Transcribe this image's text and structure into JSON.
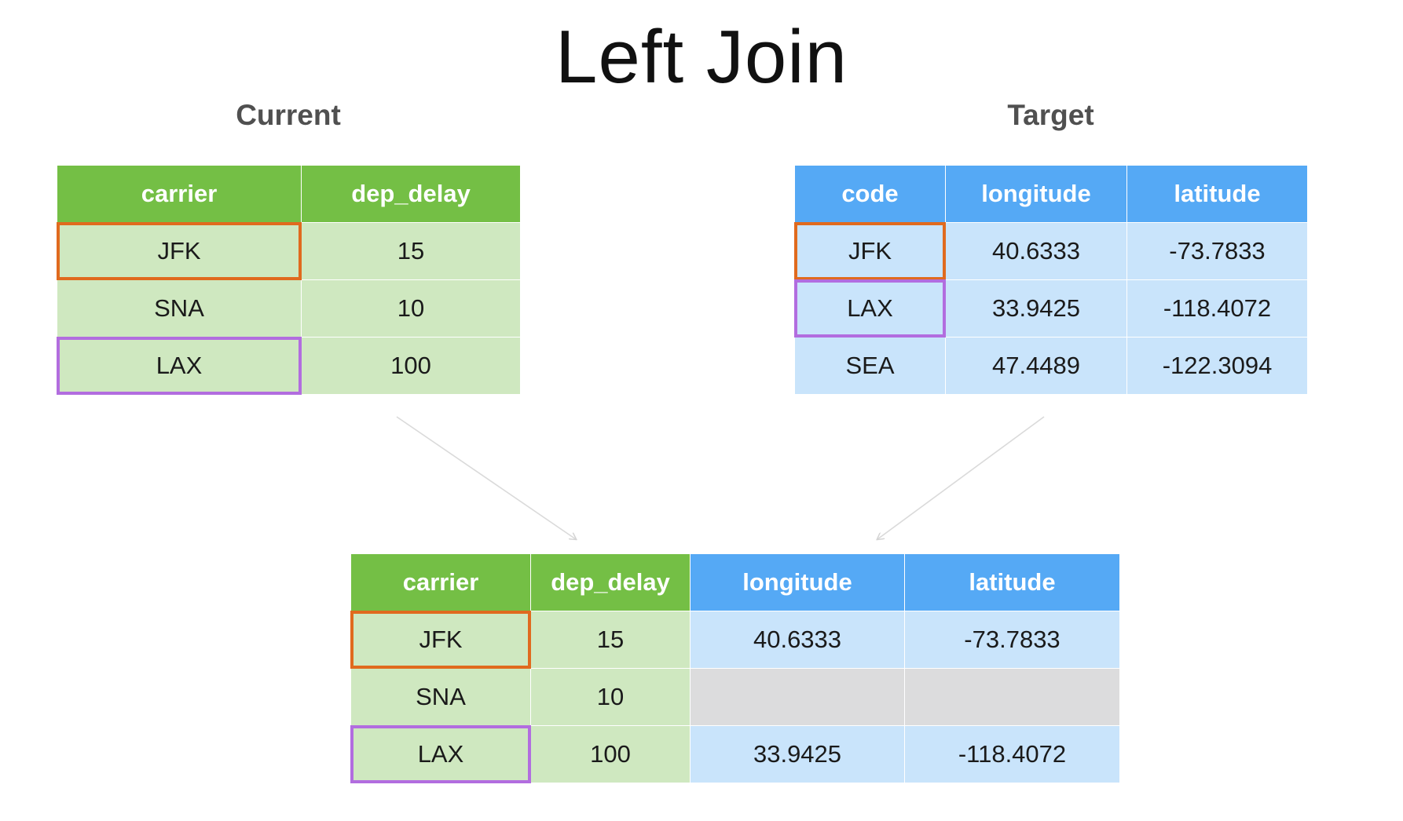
{
  "title": "Left Join",
  "current": {
    "label": "Current",
    "columns": [
      "carrier",
      "dep_delay"
    ],
    "rows": [
      {
        "carrier": "JFK",
        "dep_delay": "15"
      },
      {
        "carrier": "SNA",
        "dep_delay": "10"
      },
      {
        "carrier": "LAX",
        "dep_delay": "100"
      }
    ]
  },
  "target": {
    "label": "Target",
    "columns": [
      "code",
      "longitude",
      "latitude"
    ],
    "rows": [
      {
        "code": "JFK",
        "longitude": "40.6333",
        "latitude": "-73.7833"
      },
      {
        "code": "LAX",
        "longitude": "33.9425",
        "latitude": "-118.4072"
      },
      {
        "code": "SEA",
        "longitude": "47.4489",
        "latitude": "-122.3094"
      }
    ]
  },
  "result": {
    "columns": [
      "carrier",
      "dep_delay",
      "longitude",
      "latitude"
    ],
    "rows": [
      {
        "carrier": "JFK",
        "dep_delay": "15",
        "longitude": "40.6333",
        "latitude": "-73.7833"
      },
      {
        "carrier": "SNA",
        "dep_delay": "10",
        "longitude": "",
        "latitude": ""
      },
      {
        "carrier": "LAX",
        "dep_delay": "100",
        "longitude": "33.9425",
        "latitude": "-118.4072"
      }
    ]
  },
  "colors": {
    "current_header": "#74bf45",
    "current_cell": "#cfe8c0",
    "target_header": "#55a9f5",
    "target_cell": "#c9e4fb",
    "missing_cell": "#dcdcdd",
    "match_jfk": "#e06a1e",
    "match_lax": "#b26ddf"
  }
}
